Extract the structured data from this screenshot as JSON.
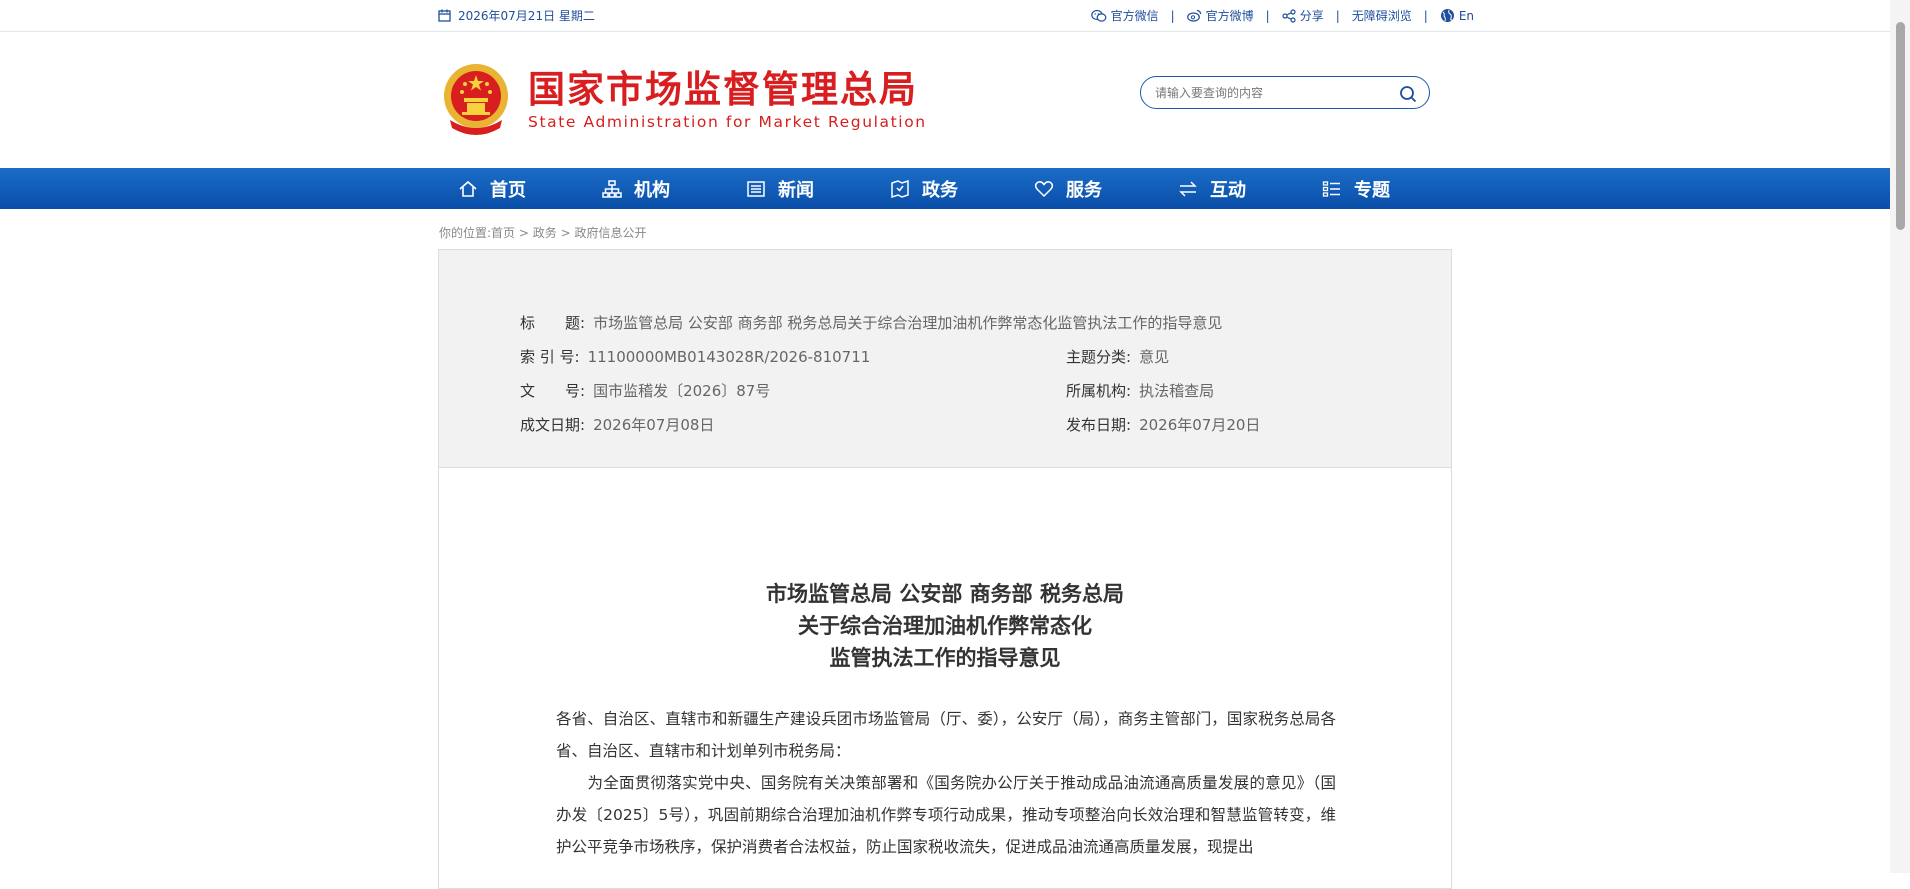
{
  "topbar": {
    "date": "2026年07月21日 星期二",
    "links": [
      {
        "label": "官方微信"
      },
      {
        "label": "官方微博"
      },
      {
        "label": "分享"
      },
      {
        "label": "无障碍浏览"
      },
      {
        "label": "En"
      }
    ],
    "separator": "|"
  },
  "header": {
    "title_cn": "国家市场监督管理总局",
    "title_en": "State Administration for Market Regulation",
    "brand_color": "#d81e1e"
  },
  "search": {
    "placeholder": "请输入要查询的内容"
  },
  "nav": {
    "items": [
      {
        "label": "首页",
        "icon": "home-icon"
      },
      {
        "label": "机构",
        "icon": "org-chart-icon"
      },
      {
        "label": "新闻",
        "icon": "news-icon"
      },
      {
        "label": "政务",
        "icon": "gov-affairs-icon"
      },
      {
        "label": "服务",
        "icon": "heart-icon"
      },
      {
        "label": "互动",
        "icon": "exchange-arrows-icon"
      },
      {
        "label": "专题",
        "icon": "list-icon"
      }
    ],
    "color": "#0a4ea8"
  },
  "breadcrumb": {
    "prefix": "你的位置:",
    "items": [
      "首页",
      "政务",
      "政府信息公开"
    ],
    "sep": " > "
  },
  "meta": {
    "title_label": "标　　题:",
    "title_value": "市场监管总局 公安部 商务部 税务总局关于综合治理加油机作弊常态化监管执法工作的指导意见",
    "index_label": "索 引 号:",
    "index_value": "11100000MB0143028R/2026-810711",
    "topic_label": "主题分类:",
    "topic_value": "意见",
    "docno_label": "文　　号:",
    "docno_value": "国市监稽发〔2026〕87号",
    "org_label": "所属机构:",
    "org_value": "执法稽查局",
    "date_label": "成文日期:",
    "date_value": "2026年07月08日",
    "pub_label": "发布日期:",
    "pub_value": "2026年07月20日"
  },
  "document": {
    "title_lines": [
      "市场监管总局 公安部 商务部 税务总局",
      "关于综合治理加油机作弊常态化",
      "监管执法工作的指导意见"
    ],
    "addressee": "各省、自治区、直辖市和新疆生产建设兵团市场监管局（厅、委），公安厅（局），商务主管部门，国家税务总局各省、自治区、直辖市和计划单列市税务局：",
    "body": "　　为全面贯彻落实党中央、国务院有关决策部署和《国务院办公厅关于推动成品油流通高质量发展的意见》（国办发〔2025〕5号），巩固前期综合治理加油机作弊专项行动成果，推动专项整治向长效治理和智慧监管转变，维护公平竞争市场秩序，保护消费者合法权益，防止国家税收流失，促进成品油流通高质量发展，现提出"
  }
}
